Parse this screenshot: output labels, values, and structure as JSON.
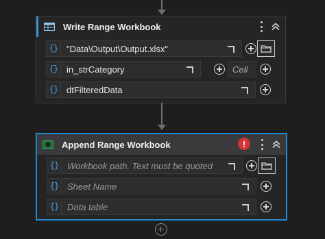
{
  "activities": [
    {
      "title": "Write Range Workbook",
      "fields": [
        {
          "value": "\"Data\\Output\\Output.xlsx\"",
          "placeholder": false
        },
        {
          "value": "in_strCategory",
          "placeholder": false,
          "side_label": "Cell"
        },
        {
          "value": "dtFilteredData",
          "placeholder": false
        }
      ]
    },
    {
      "title": "Append Range Workbook",
      "error_symbol": "!",
      "fields": [
        {
          "value": "Workbook path. Text must be quoted",
          "placeholder": true
        },
        {
          "value": "Sheet Name",
          "placeholder": true
        },
        {
          "value": "Data table",
          "placeholder": true
        }
      ]
    }
  ],
  "brace_glyph": "{}",
  "colors": {
    "background": "#1e1e1e",
    "accent": "#1f8ad2",
    "brace": "#4aa3e8",
    "error": "#d13438"
  }
}
